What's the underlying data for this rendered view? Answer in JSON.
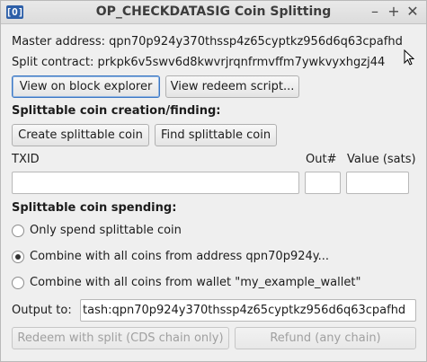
{
  "window": {
    "title": "OP_CHECKDATASIG Coin Splitting",
    "icon_text": "[O]",
    "controls": [
      "minimize-icon",
      "maximize-icon",
      "close-icon"
    ]
  },
  "info": {
    "master_address": "Master address: qpn70p924y370thssp4z65cyptkz956d6q63cpafhd",
    "split_contract": "Split contract: prkpk6v5swv6d8kwvrjrqnfrmvffm7ywkvyxhgzj44"
  },
  "buttons": {
    "view_block_explorer": "View on block explorer",
    "view_redeem_script": "View redeem script...",
    "create_splittable": "Create splittable coin",
    "find_splittable": "Find splittable coin",
    "redeem_split": "Redeem with split (CDS chain only)",
    "refund": "Refund (any chain)"
  },
  "creation": {
    "heading": "Splittable coin creation/finding:"
  },
  "fields": {
    "txid_label": "TXID",
    "out_label": "Out#",
    "value_label": "Value (sats)",
    "txid_value": "",
    "out_value": "",
    "value_value": ""
  },
  "spending": {
    "heading": "Splittable coin spending:",
    "options": [
      "Only spend splittable coin",
      "Combine with all coins from address qpn70p924y...",
      "Combine with all coins from wallet \"my_example_wallet\""
    ],
    "selected_index": 1,
    "output_label": "Output to:",
    "output_value": "tash:qpn70p924y370thssp4z65cyptkz956d6q63cpafhd"
  }
}
